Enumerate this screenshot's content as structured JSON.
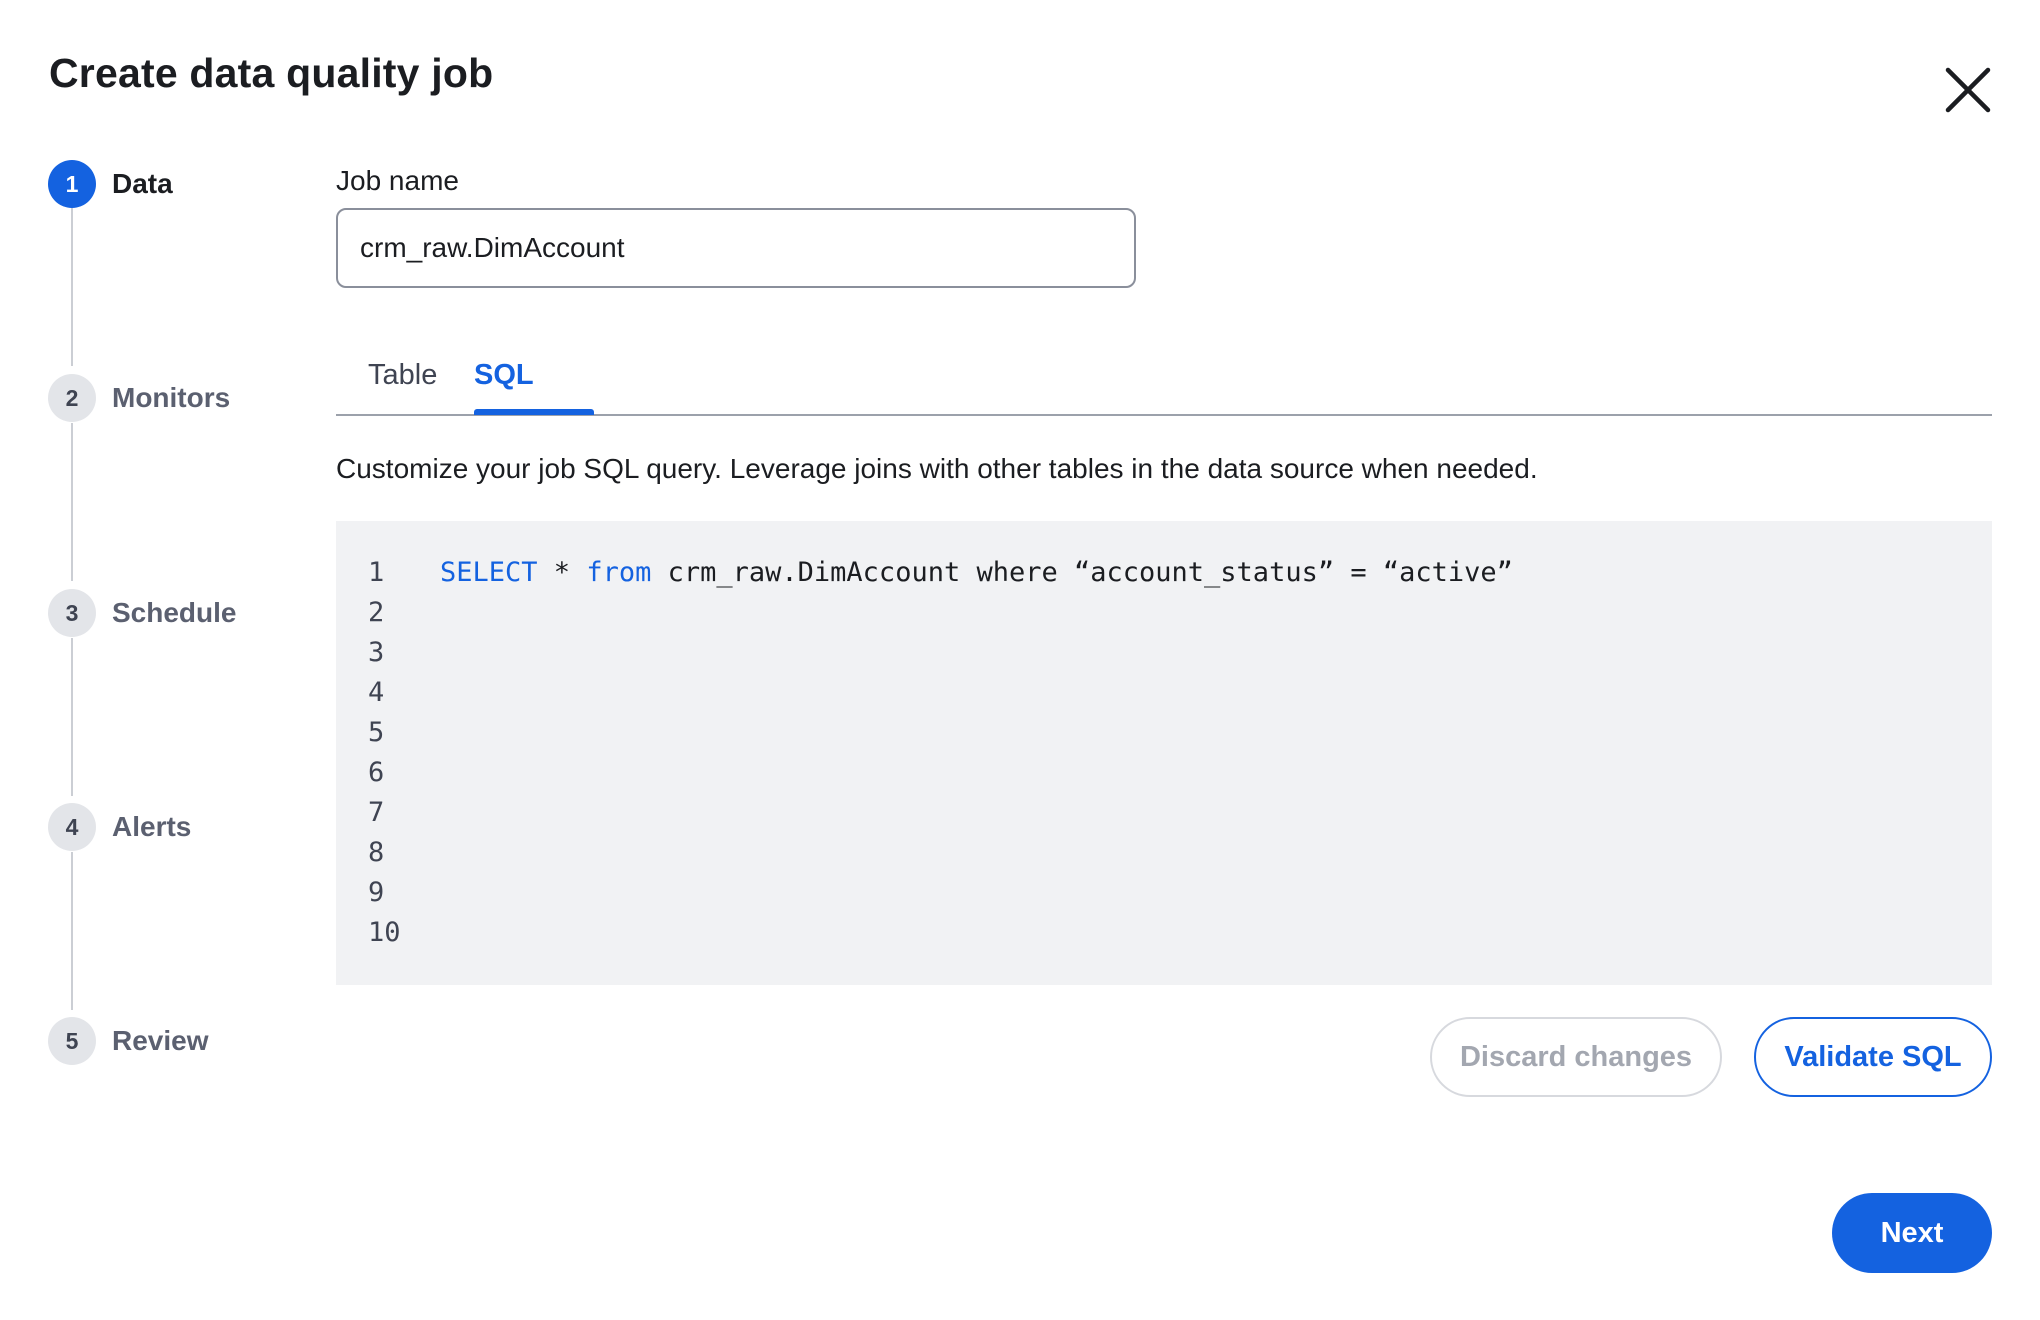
{
  "dialog": {
    "title": "Create data quality job",
    "close_icon": "close-icon"
  },
  "stepper": {
    "steps": [
      {
        "number": "1",
        "label": "Data",
        "state": "active"
      },
      {
        "number": "2",
        "label": "Monitors",
        "state": "pending"
      },
      {
        "number": "3",
        "label": "Schedule",
        "state": "pending"
      },
      {
        "number": "4",
        "label": "Alerts",
        "state": "pending"
      },
      {
        "number": "5",
        "label": "Review",
        "state": "pending"
      }
    ]
  },
  "form": {
    "job_name_label": "Job name",
    "job_name_value": "crm_raw.DimAccount"
  },
  "tabs": {
    "items": [
      {
        "label": "Table",
        "selected": false
      },
      {
        "label": "SQL",
        "selected": true
      }
    ]
  },
  "sql": {
    "description": "Customize your job SQL query. Leverage joins with other tables in the data source when needed.",
    "line_numbers": [
      "1",
      "2",
      "3",
      "4",
      "5",
      "6",
      "7",
      "8",
      "9",
      "10"
    ],
    "query": {
      "kw_select": "SELECT",
      "star": " * ",
      "kw_from": "from",
      "rest": " crm_raw.DimAccount where “account_status” = “active”"
    }
  },
  "actions": {
    "discard_label": "Discard changes",
    "validate_label": "Validate SQL",
    "next_label": "Next"
  },
  "colors": {
    "accent": "#1462e0",
    "editor_bg": "#f1f2f4",
    "disabled_text": "#a3a7b0"
  }
}
